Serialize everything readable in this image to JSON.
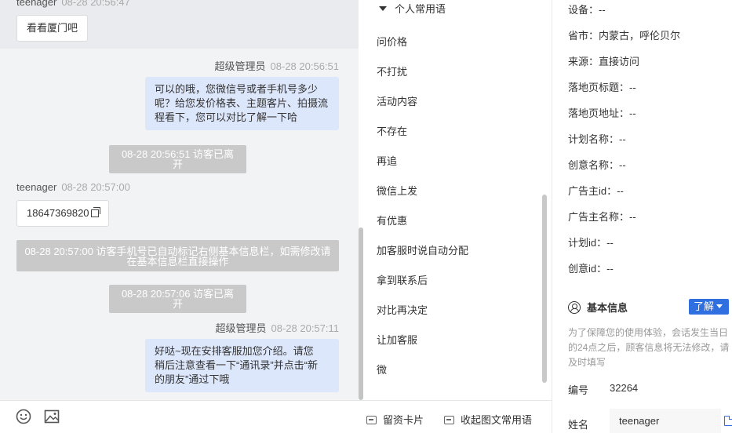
{
  "chat": {
    "messages": [
      {
        "sender": "teenager",
        "time": "08-28 20:56:47",
        "text": "看看厦门吧"
      },
      {
        "sender": "超级管理员",
        "time": "08-28 20:56:51",
        "lines": [
          "可以的哦，您微信号或者手机号多少",
          "呢？给您发价格表、主题客片、拍摄流",
          "程看下，您可以对比了解一下哈"
        ]
      },
      {
        "system": "08-28 20:56:51 访客已离开"
      },
      {
        "sender": "teenager",
        "time": "08-28 20:57:00",
        "text": "18647369820"
      },
      {
        "system_lines": [
          "08-28 20:57:00 访客手机号已自动标记右侧基本信息栏，如需修改请",
          "在基本信息栏直接操作"
        ]
      },
      {
        "system": "08-28 20:57:06 访客已离开"
      },
      {
        "sender": "超级管理员",
        "time": "08-28 20:57:11",
        "lines": [
          "好哒~现在安排客服加您介绍。请您",
          "稍后注意查看一下“通讯录”并点击“新",
          "的朋友”通过下哦"
        ]
      }
    ]
  },
  "input_bar": {
    "icons": [
      "emoji-icon",
      "image-icon"
    ]
  },
  "phrases": {
    "header": "个人常用语",
    "items": [
      "问价格",
      "不打扰",
      "活动内容",
      "不存在",
      "再追",
      "微信上发",
      "有优惠",
      "加客服时说自动分配",
      "拿到联系后",
      "对比再决定",
      "让加客服",
      "微"
    ],
    "footer": {
      "card_label": "留资卡片",
      "collapse_label": "收起图文常用语"
    }
  },
  "info": {
    "rows": [
      "设备：--",
      "省市：内蒙古，呼伦贝尔",
      "来源：直接访问",
      "落地页标题：--",
      "落地页地址：--",
      "计划名称：--",
      "创意名称：--",
      "广告主id：--",
      "广告主名称：--",
      "计划id：--",
      "创意id：--"
    ],
    "basic_title": "基本信息",
    "learn_label": "了解",
    "note_lines": [
      "为了保障您的使用体验，会话发生当日",
      "的24点之后，顾客信息将无法修改，请",
      "及时填写"
    ],
    "id_label": "编号",
    "id_value": "32264",
    "name_label": "姓名",
    "name_value": "teenager"
  }
}
